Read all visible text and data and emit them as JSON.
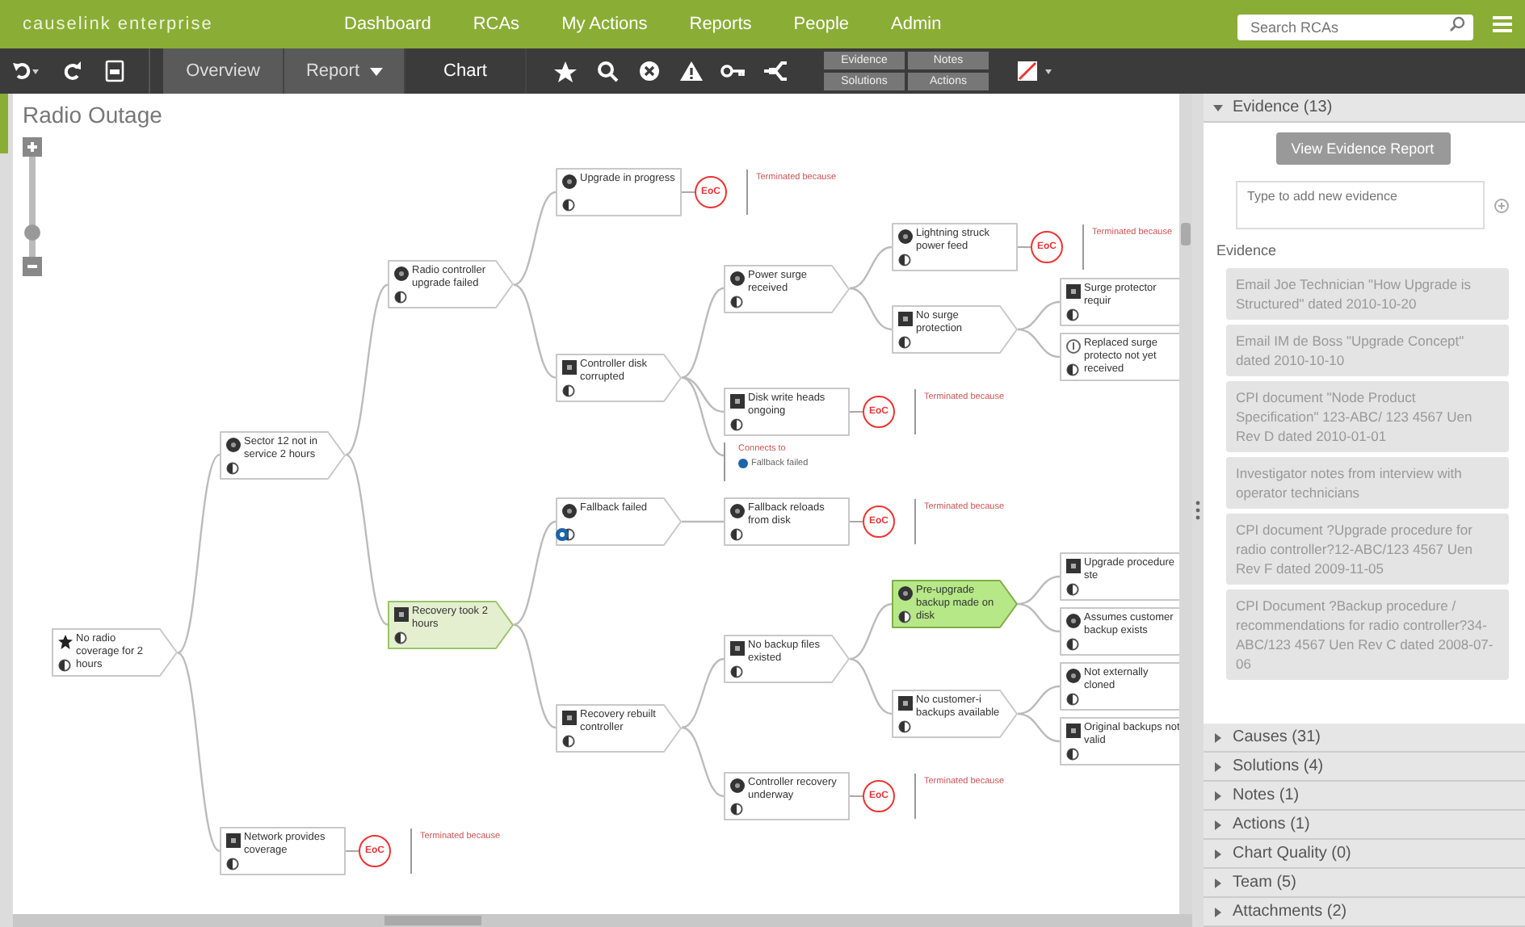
{
  "header": {
    "brand": "causelink enterprise",
    "nav": [
      {
        "label": "Dashboard"
      },
      {
        "label": "RCAs"
      },
      {
        "label": "My Actions"
      },
      {
        "label": "Reports"
      },
      {
        "label": "People"
      },
      {
        "label": "Admin"
      }
    ],
    "search": {
      "placeholder": "Search RCAs"
    }
  },
  "toolbar": {
    "tabs": [
      {
        "label": "Overview",
        "selected": false,
        "dropdown": false
      },
      {
        "label": "Report",
        "selected": false,
        "dropdown": true
      },
      {
        "label": "Chart",
        "selected": true,
        "dropdown": false
      }
    ],
    "panel_buttons": [
      "Evidence",
      "Notes",
      "Solutions",
      "Actions"
    ]
  },
  "chart": {
    "title": "Radio Outage",
    "zoom": {
      "level": 0.25
    },
    "root": {
      "kind": "star",
      "label": "No radio coverage for 2 hours",
      "selected": false,
      "highlighted": false,
      "linked": false,
      "children": [
        {
          "kind": "circle",
          "label": "Sector 12 not in service 2 hours",
          "selected": false,
          "highlighted": false,
          "linked": false,
          "children": [
            {
              "kind": "circle",
              "label": "Radio controller upgrade failed",
              "selected": false,
              "highlighted": false,
              "linked": false,
              "children": [
                {
                  "kind": "circle",
                  "label": "Upgrade in progress",
                  "selected": false,
                  "highlighted": false,
                  "linked": false,
                  "eoc": {
                    "badge": "EoC",
                    "note": "Terminated because"
                  }
                },
                {
                  "kind": "square",
                  "label": "Controller disk corrupted",
                  "selected": false,
                  "highlighted": false,
                  "linked": false,
                  "children": [
                    {
                      "kind": "circle",
                      "label": "Power surge received",
                      "selected": false,
                      "highlighted": false,
                      "linked": false,
                      "children": [
                        {
                          "kind": "circle",
                          "label": "Lightning struck power feed",
                          "selected": false,
                          "highlighted": false,
                          "linked": false,
                          "eoc": {
                            "badge": "EoC",
                            "note": "Terminated because"
                          }
                        },
                        {
                          "kind": "square",
                          "label": "No surge protection",
                          "selected": false,
                          "highlighted": false,
                          "linked": false,
                          "children": [
                            {
                              "kind": "square",
                              "label": "Surge protector requir",
                              "selected": false,
                              "highlighted": false,
                              "linked": false
                            },
                            {
                              "kind": "info",
                              "label": "Replaced surge protecto not yet received",
                              "selected": false,
                              "highlighted": false,
                              "linked": false
                            }
                          ]
                        }
                      ]
                    },
                    {
                      "kind": "square",
                      "label": "Disk write heads ongoing",
                      "selected": false,
                      "highlighted": false,
                      "linked": false,
                      "eoc": {
                        "badge": "EoC",
                        "note": "Terminated because"
                      }
                    },
                    {
                      "kind": "link",
                      "title": "Connects to",
                      "target": "Fallback failed"
                    }
                  ]
                }
              ]
            },
            {
              "kind": "square",
              "label": "Recovery took 2 hours",
              "selected": false,
              "highlighted": true,
              "linked": false,
              "children": [
                {
                  "kind": "circle",
                  "label": "Fallback failed",
                  "selected": false,
                  "highlighted": false,
                  "linked": true,
                  "children": [
                    {
                      "kind": "circle",
                      "label": "Fallback reloads from disk",
                      "selected": false,
                      "highlighted": false,
                      "linked": false,
                      "eoc": {
                        "badge": "EoC",
                        "note": "Terminated because"
                      }
                    }
                  ]
                },
                {
                  "kind": "square",
                  "label": "Recovery rebuilt controller",
                  "selected": false,
                  "highlighted": false,
                  "linked": false,
                  "children": [
                    {
                      "kind": "square",
                      "label": "No backup files existed",
                      "selected": false,
                      "highlighted": false,
                      "linked": false,
                      "children": [
                        {
                          "kind": "circle",
                          "label": "Pre-upgrade backup made on disk",
                          "selected": true,
                          "highlighted": false,
                          "linked": false,
                          "children": [
                            {
                              "kind": "square",
                              "label": "Upgrade procedure ste",
                              "selected": false,
                              "highlighted": false,
                              "linked": false
                            },
                            {
                              "kind": "circle",
                              "label": "Assumes customer backup exists",
                              "selected": false,
                              "highlighted": false,
                              "linked": false
                            }
                          ]
                        },
                        {
                          "kind": "square",
                          "label": "No customer-i backups available",
                          "selected": false,
                          "highlighted": false,
                          "linked": false,
                          "children": [
                            {
                              "kind": "circle",
                              "label": "Not externally cloned",
                              "selected": false,
                              "highlighted": false,
                              "linked": false
                            },
                            {
                              "kind": "square",
                              "label": "Original backups not valid",
                              "selected": false,
                              "highlighted": false,
                              "linked": false
                            }
                          ]
                        }
                      ]
                    },
                    {
                      "kind": "circle",
                      "label": "Controller recovery underway",
                      "selected": false,
                      "highlighted": false,
                      "linked": false,
                      "eoc": {
                        "badge": "EoC",
                        "note": "Terminated because"
                      }
                    }
                  ]
                }
              ]
            }
          ]
        },
        {
          "kind": "square",
          "label": "Network provides coverage",
          "selected": false,
          "highlighted": false,
          "linked": false,
          "eoc": {
            "badge": "EoC",
            "note": "Terminated because"
          }
        }
      ]
    }
  },
  "sidebar": {
    "sections": [
      {
        "title": "Evidence (13)",
        "expanded": true
      },
      {
        "title": "Causes (31)",
        "expanded": false
      },
      {
        "title": "Solutions (4)",
        "expanded": false
      },
      {
        "title": "Notes (1)",
        "expanded": false
      },
      {
        "title": "Actions (1)",
        "expanded": false
      },
      {
        "title": "Chart Quality (0)",
        "expanded": false
      },
      {
        "title": "Team (5)",
        "expanded": false
      },
      {
        "title": "Attachments (2)",
        "expanded": false
      }
    ],
    "evidence": {
      "button": "View Evidence Report",
      "input": {
        "placeholder": "Type to add new evidence"
      },
      "heading": "Evidence",
      "items": [
        "Email Joe Technician \"How Upgrade is Structured\" dated 2010-10-20",
        "Email IM de Boss \"Upgrade Concept\" dated 2010-10-10",
        "CPI document \"Node Product Specification\" 123-ABC/ 123 4567 Uen Rev D dated 2010-01-01",
        "Investigator notes from interview with operator technicians",
        "CPI document ?Upgrade procedure for radio controller?12-ABC/123 4567 Uen Rev F dated 2009-11-05",
        "CPI Document ?Backup procedure / recommendations for radio controller?34-ABC/123 4567 Uen Rev C dated 2008-07-06"
      ]
    }
  }
}
